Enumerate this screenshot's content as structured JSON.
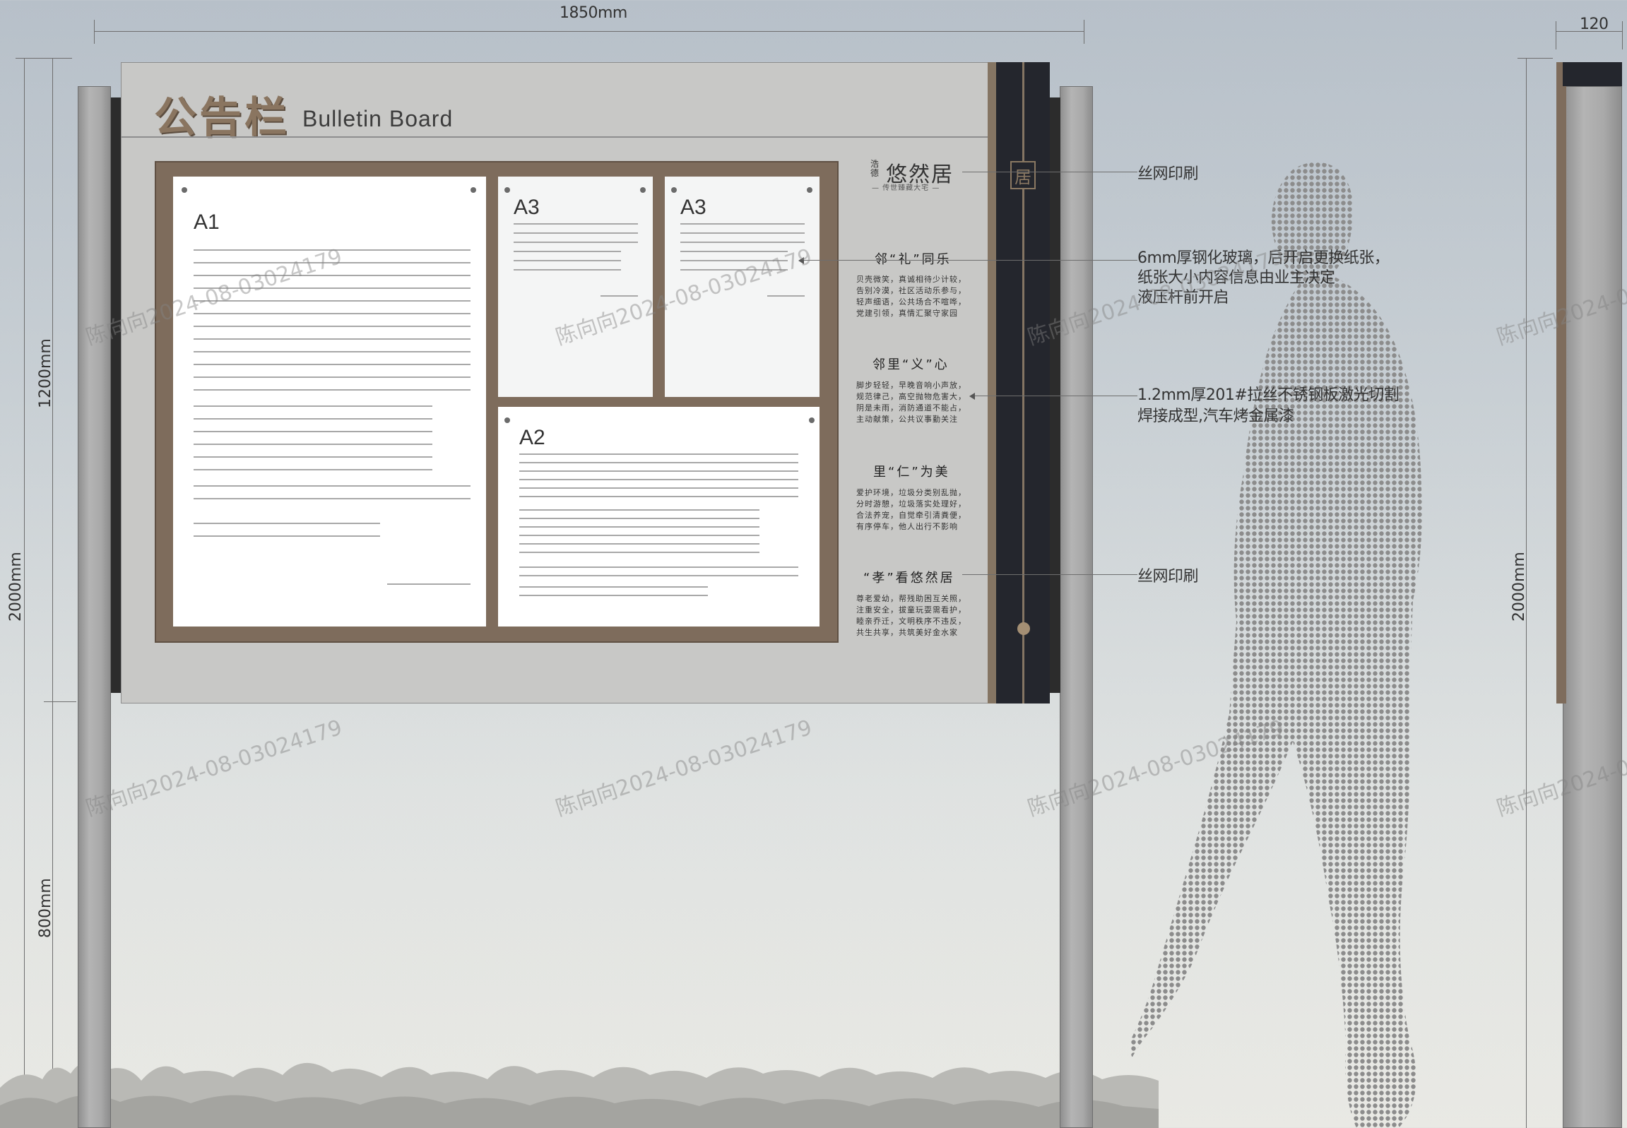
{
  "dimensions": {
    "width": "1850mm",
    "depth": "120",
    "board_height": "1200mm",
    "base_height": "800mm",
    "total_height": "2000mm",
    "side_height": "2000mm"
  },
  "board": {
    "title_cn": "公告栏",
    "title_en": "Bulletin Board"
  },
  "panels": [
    {
      "label": "A1"
    },
    {
      "label": "A3"
    },
    {
      "label": "A3"
    },
    {
      "label": "A2"
    }
  ],
  "brand": {
    "small": "浩德",
    "name": "悠然居",
    "tagline": "— 传世臻藏大宅 —"
  },
  "sections": [
    {
      "title": "邻“礼”同乐",
      "body": "贝壳微笑，真诚相待少计较，告别冷漠，社区活动乐参与，轻声细语，公共场合不喧哗，党建引领，真情汇聚守家园"
    },
    {
      "title": "邻里“义”心",
      "body": "脚步轻轻，早晚音响小声放，规范律己，高空抛物危害大，阴是未雨，消防通道不能占，主动献策，公共议事勤关注"
    },
    {
      "title": "里“仁”为美",
      "body": "爱护环境，垃圾分类别乱抛，分时游憩，垃圾落实处理好，合法养宠，自觉牵引清粪便，有序停车，他人出行不影响"
    },
    {
      "title": "“孝”看悠然居",
      "body": "尊老爱幼，帮残助困互关照，注重安全，拔童玩耍需看护，睦亲乔迁，文明秩序不违反，共生共享，共筑美好金水家"
    }
  ],
  "column_emblem": "居",
  "annotations": [
    {
      "text": "丝网印刷"
    },
    {
      "text": "6mm厚钢化玻璃，后开启更换纸张，\n纸张大小内容信息由业主决定\n液压杆前开启"
    },
    {
      "text": "1.2mm厚201#拉丝不锈钢板激光切割\n焊接成型,汽车烤金属漆"
    },
    {
      "text": "丝网印刷"
    }
  ],
  "watermark": "陈向向2024-08-03024179",
  "colors": {
    "frame_brown": "#7e6c5c",
    "column_dark": "#24262d",
    "board_grey": "#c8c8c6",
    "title_gold": "#8a7560"
  }
}
